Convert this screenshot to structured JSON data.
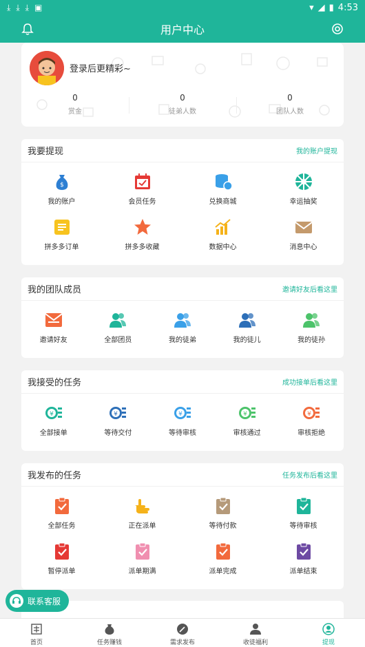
{
  "status_bar": {
    "time": "4:53"
  },
  "header": {
    "title": "用户中心",
    "bell_icon": "bell-icon",
    "settings_icon": "settings-icon"
  },
  "profile": {
    "login_prompt": "登录后更精彩~",
    "stats": [
      {
        "value": "0",
        "label": "赏金"
      },
      {
        "value": "0",
        "label": "徒弟人数"
      },
      {
        "value": "0",
        "label": "团队人数"
      }
    ]
  },
  "withdraw": {
    "title": "我要提现",
    "link": "我的账户提现",
    "items": [
      {
        "label": "我的账户",
        "icon": "money-bag-icon",
        "color": "#2d7fd3"
      },
      {
        "label": "会员任务",
        "icon": "calendar-check-icon",
        "color": "#e53935"
      },
      {
        "label": "兑换商城",
        "icon": "coin-stack-icon",
        "color": "#3aa0e8"
      },
      {
        "label": "幸运抽奖",
        "icon": "wheel-icon",
        "color": "#1fb59a"
      },
      {
        "label": "拼多多订单",
        "icon": "order-icon",
        "color": "#f7c31f"
      },
      {
        "label": "拼多多收藏",
        "icon": "star-icon",
        "color": "#f26a3d"
      },
      {
        "label": "数据中心",
        "icon": "chart-icon",
        "color": "#f5b21a"
      },
      {
        "label": "消息中心",
        "icon": "mail-icon",
        "color": "#c49a6c"
      }
    ]
  },
  "team": {
    "title": "我的团队成员",
    "link": "邀请好友后看这里",
    "items": [
      {
        "label": "邀请好友",
        "icon": "invite-icon",
        "color": "#f26a3d"
      },
      {
        "label": "全部团员",
        "icon": "team-icon",
        "color": "#1fb59a"
      },
      {
        "label": "我的徒弟",
        "icon": "team-icon",
        "color": "#3aa0e8"
      },
      {
        "label": "我的徒儿",
        "icon": "team-icon",
        "color": "#2d6fb8"
      },
      {
        "label": "我的徒孙",
        "icon": "team-icon",
        "color": "#4cc36a"
      }
    ]
  },
  "accepted": {
    "title": "我接受的任务",
    "link": "成功接单后看这里",
    "items": [
      {
        "label": "全部接单",
        "icon": "coin-list-icon",
        "color": "#1fb59a"
      },
      {
        "label": "等待交付",
        "icon": "coin-list-icon",
        "color": "#2d6fb8"
      },
      {
        "label": "等待审核",
        "icon": "coin-list-icon",
        "color": "#3aa0e8"
      },
      {
        "label": "审核通过",
        "icon": "coin-list-icon",
        "color": "#4cc36a"
      },
      {
        "label": "审核拒绝",
        "icon": "coin-list-icon",
        "color": "#f26a3d"
      }
    ]
  },
  "published": {
    "title": "我发布的任务",
    "link": "任务发布后看这里",
    "items": [
      {
        "label": "全部任务",
        "icon": "clipboard-check-icon",
        "color": "#f26a3d"
      },
      {
        "label": "正在派单",
        "icon": "pointing-hand-icon",
        "color": "#f5b21a"
      },
      {
        "label": "等待付款",
        "icon": "clipboard-check-icon",
        "color": "#b59a7a"
      },
      {
        "label": "等待审核",
        "icon": "clipboard-check-icon",
        "color": "#1fb59a"
      },
      {
        "label": "暂停派单",
        "icon": "clipboard-check-icon",
        "color": "#e53935"
      },
      {
        "label": "派单期满",
        "icon": "clipboard-check-icon",
        "color": "#f08fb0"
      },
      {
        "label": "派单完成",
        "icon": "clipboard-check-icon",
        "color": "#f26a3d"
      },
      {
        "label": "派单结束",
        "icon": "clipboard-check-icon",
        "color": "#6d4aa3"
      }
    ]
  },
  "contact": {
    "label": "联系客服",
    "icon": "headset-icon"
  },
  "tabs": [
    {
      "label": "首页",
      "icon": "home-icon",
      "active": false
    },
    {
      "label": "任务赚钱",
      "icon": "money-bag-icon",
      "active": false
    },
    {
      "label": "需求发布",
      "icon": "publish-icon",
      "active": false
    },
    {
      "label": "收徒福利",
      "icon": "user-icon",
      "active": false
    },
    {
      "label": "提现",
      "icon": "withdraw-icon",
      "active": true
    }
  ],
  "colors": {
    "primary": "#1fb59a",
    "background": "#f2f2f2"
  }
}
